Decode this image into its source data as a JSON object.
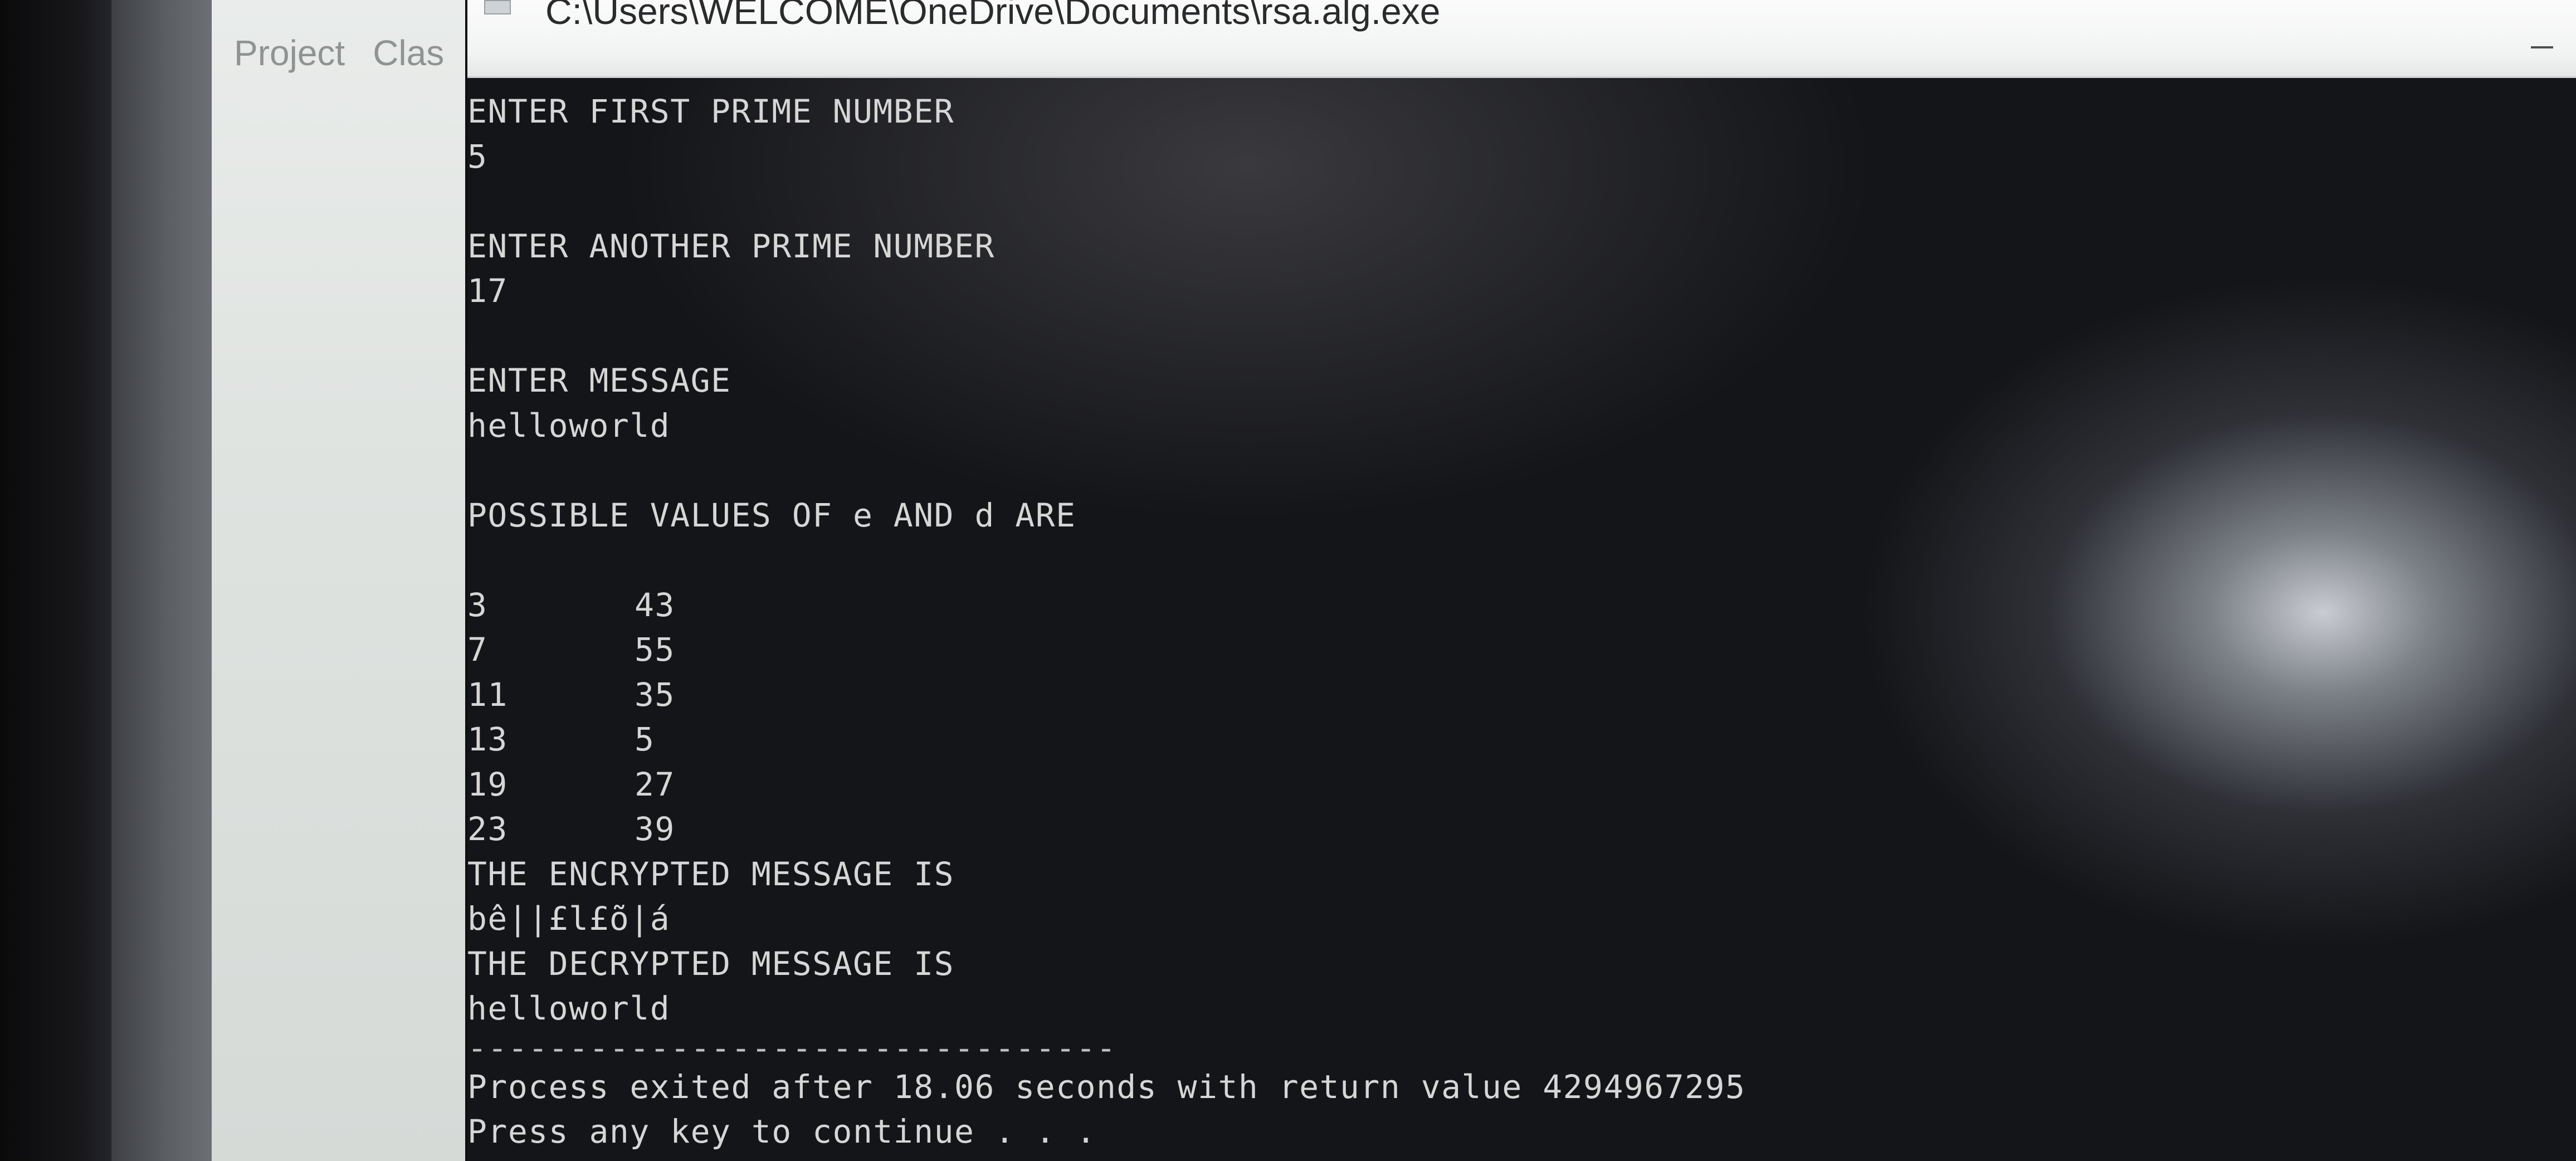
{
  "ide": {
    "tabs": [
      "Project",
      "Clas"
    ]
  },
  "window": {
    "title": "C:\\Users\\WELCOME\\OneDrive\\Documents\\rsa.alg.exe"
  },
  "console": {
    "prompt_first_prime": "ENTER FIRST PRIME NUMBER",
    "first_prime": "5",
    "prompt_another_prime": "ENTER ANOTHER PRIME NUMBER",
    "another_prime": "17",
    "prompt_message": "ENTER MESSAGE",
    "message": "helloworld",
    "possible_values_header": "POSSIBLE VALUES OF e AND d ARE",
    "ed_pairs": [
      {
        "e": "3",
        "d": "43"
      },
      {
        "e": "7",
        "d": "55"
      },
      {
        "e": "11",
        "d": "35"
      },
      {
        "e": "13",
        "d": "5"
      },
      {
        "e": "19",
        "d": "27"
      },
      {
        "e": "23",
        "d": "39"
      }
    ],
    "encrypted_header": "THE ENCRYPTED MESSAGE IS",
    "encrypted_message": "bê||£l£õ|á",
    "decrypted_header": "THE DECRYPTED MESSAGE IS",
    "decrypted_message": "helloworld",
    "separator": "--------------------------------",
    "process_exit": "Process exited after 18.06 seconds with return value 4294967295",
    "press_key": "Press any key to continue . . ."
  }
}
